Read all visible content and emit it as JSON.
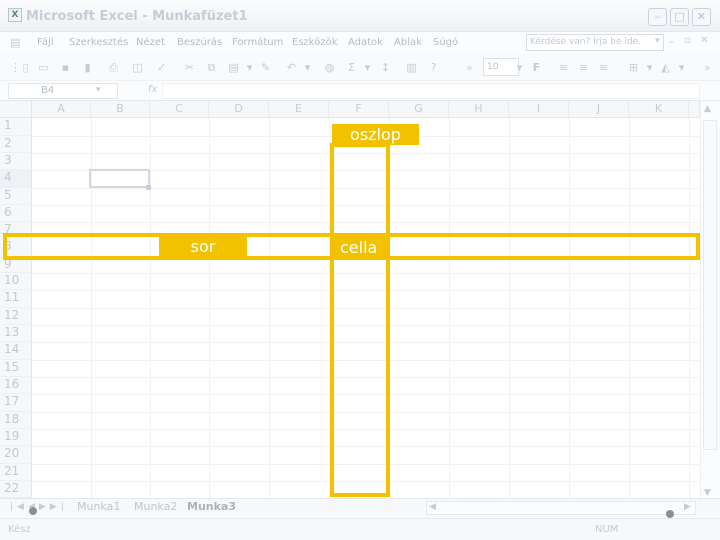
{
  "window": {
    "title": "Microsoft Excel - Munkafüzet1",
    "app_icon": "excel-icon"
  },
  "menu": [
    "Fájl",
    "Szerkesztés",
    "Nézet",
    "Beszúrás",
    "Formátum",
    "Eszközök",
    "Adatok",
    "Ablak",
    "Súgó"
  ],
  "help_placeholder": "Kérdése van? Írja be ide.",
  "toolbar": {
    "font_size": "10",
    "bold_label": "F",
    "sum_label": "Σ"
  },
  "formula_bar": {
    "name_box": "B4",
    "fx_label": "fx"
  },
  "columns": [
    "A",
    "B",
    "C",
    "D",
    "E",
    "F",
    "G",
    "H",
    "I",
    "J",
    "K"
  ],
  "rows": [
    "1",
    "2",
    "3",
    "4",
    "5",
    "6",
    "7",
    "8",
    "9",
    "10",
    "11",
    "12",
    "13",
    "14",
    "15",
    "16",
    "17",
    "18",
    "19",
    "20",
    "21",
    "22"
  ],
  "sheets": [
    "Munka1",
    "Munka2",
    "Munka3"
  ],
  "status": {
    "ready": "Kész",
    "num": "NUM"
  },
  "annotations": {
    "column_label": "oszlop",
    "row_label": "sor",
    "cell_label": "cella",
    "highlight_color": "#f2c200"
  }
}
